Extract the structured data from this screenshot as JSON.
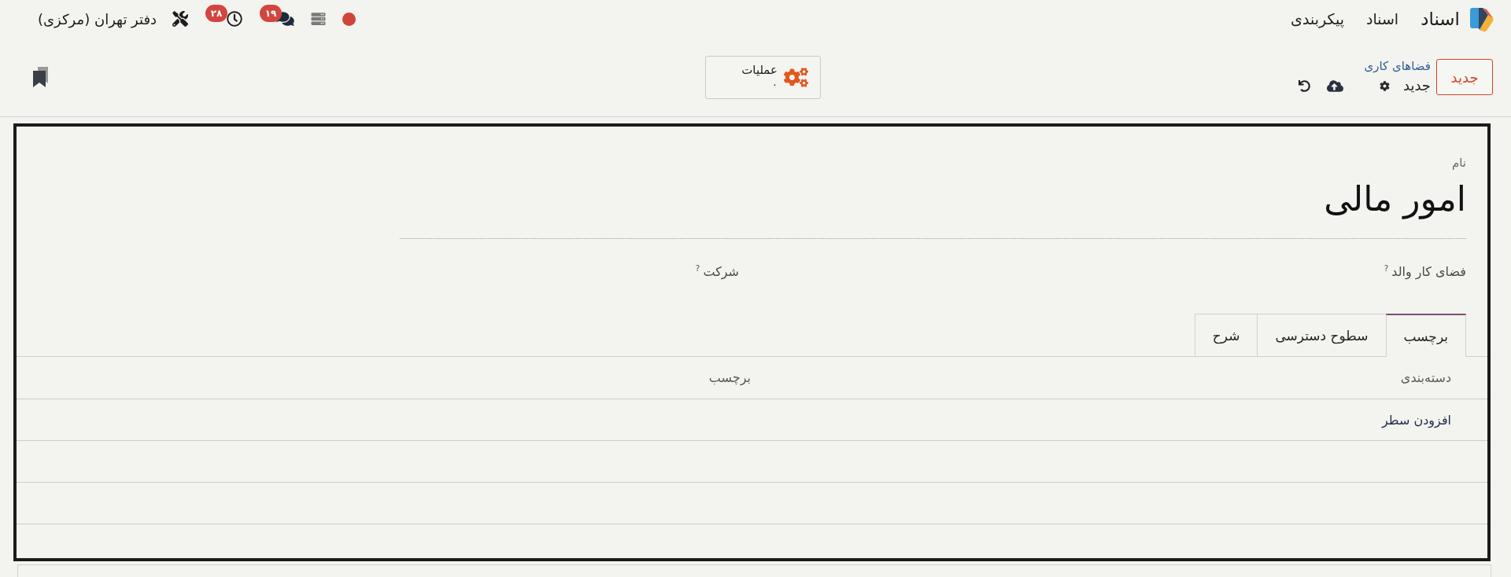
{
  "navbar": {
    "app_name": "اسناد",
    "menu": [
      "اسناد",
      "پیکربندی"
    ],
    "messages_badge": "۱۹",
    "activities_badge": "۲۸",
    "company": "دفتر تهران (مرکزی)"
  },
  "control_panel": {
    "new_button": "جدید",
    "breadcrumb": "فضاهای کاری",
    "record_title": "جدید",
    "smart_button": {
      "label": "عملیات",
      "value": "۰"
    }
  },
  "form": {
    "name_field": {
      "label": "نام",
      "value": "امور مالی"
    },
    "fields": [
      {
        "label": "فضای کار والد",
        "help": "?"
      },
      {
        "label": "شرکت",
        "help": "?"
      }
    ],
    "tabs": [
      {
        "label": "برچسب",
        "selected": true
      },
      {
        "label": "سطوح دسترسی",
        "selected": false
      },
      {
        "label": "شرح",
        "selected": false
      }
    ],
    "table": {
      "columns": [
        "دسته‌بندی",
        "برچسب"
      ],
      "add_line": "افزودن سطر"
    }
  }
}
